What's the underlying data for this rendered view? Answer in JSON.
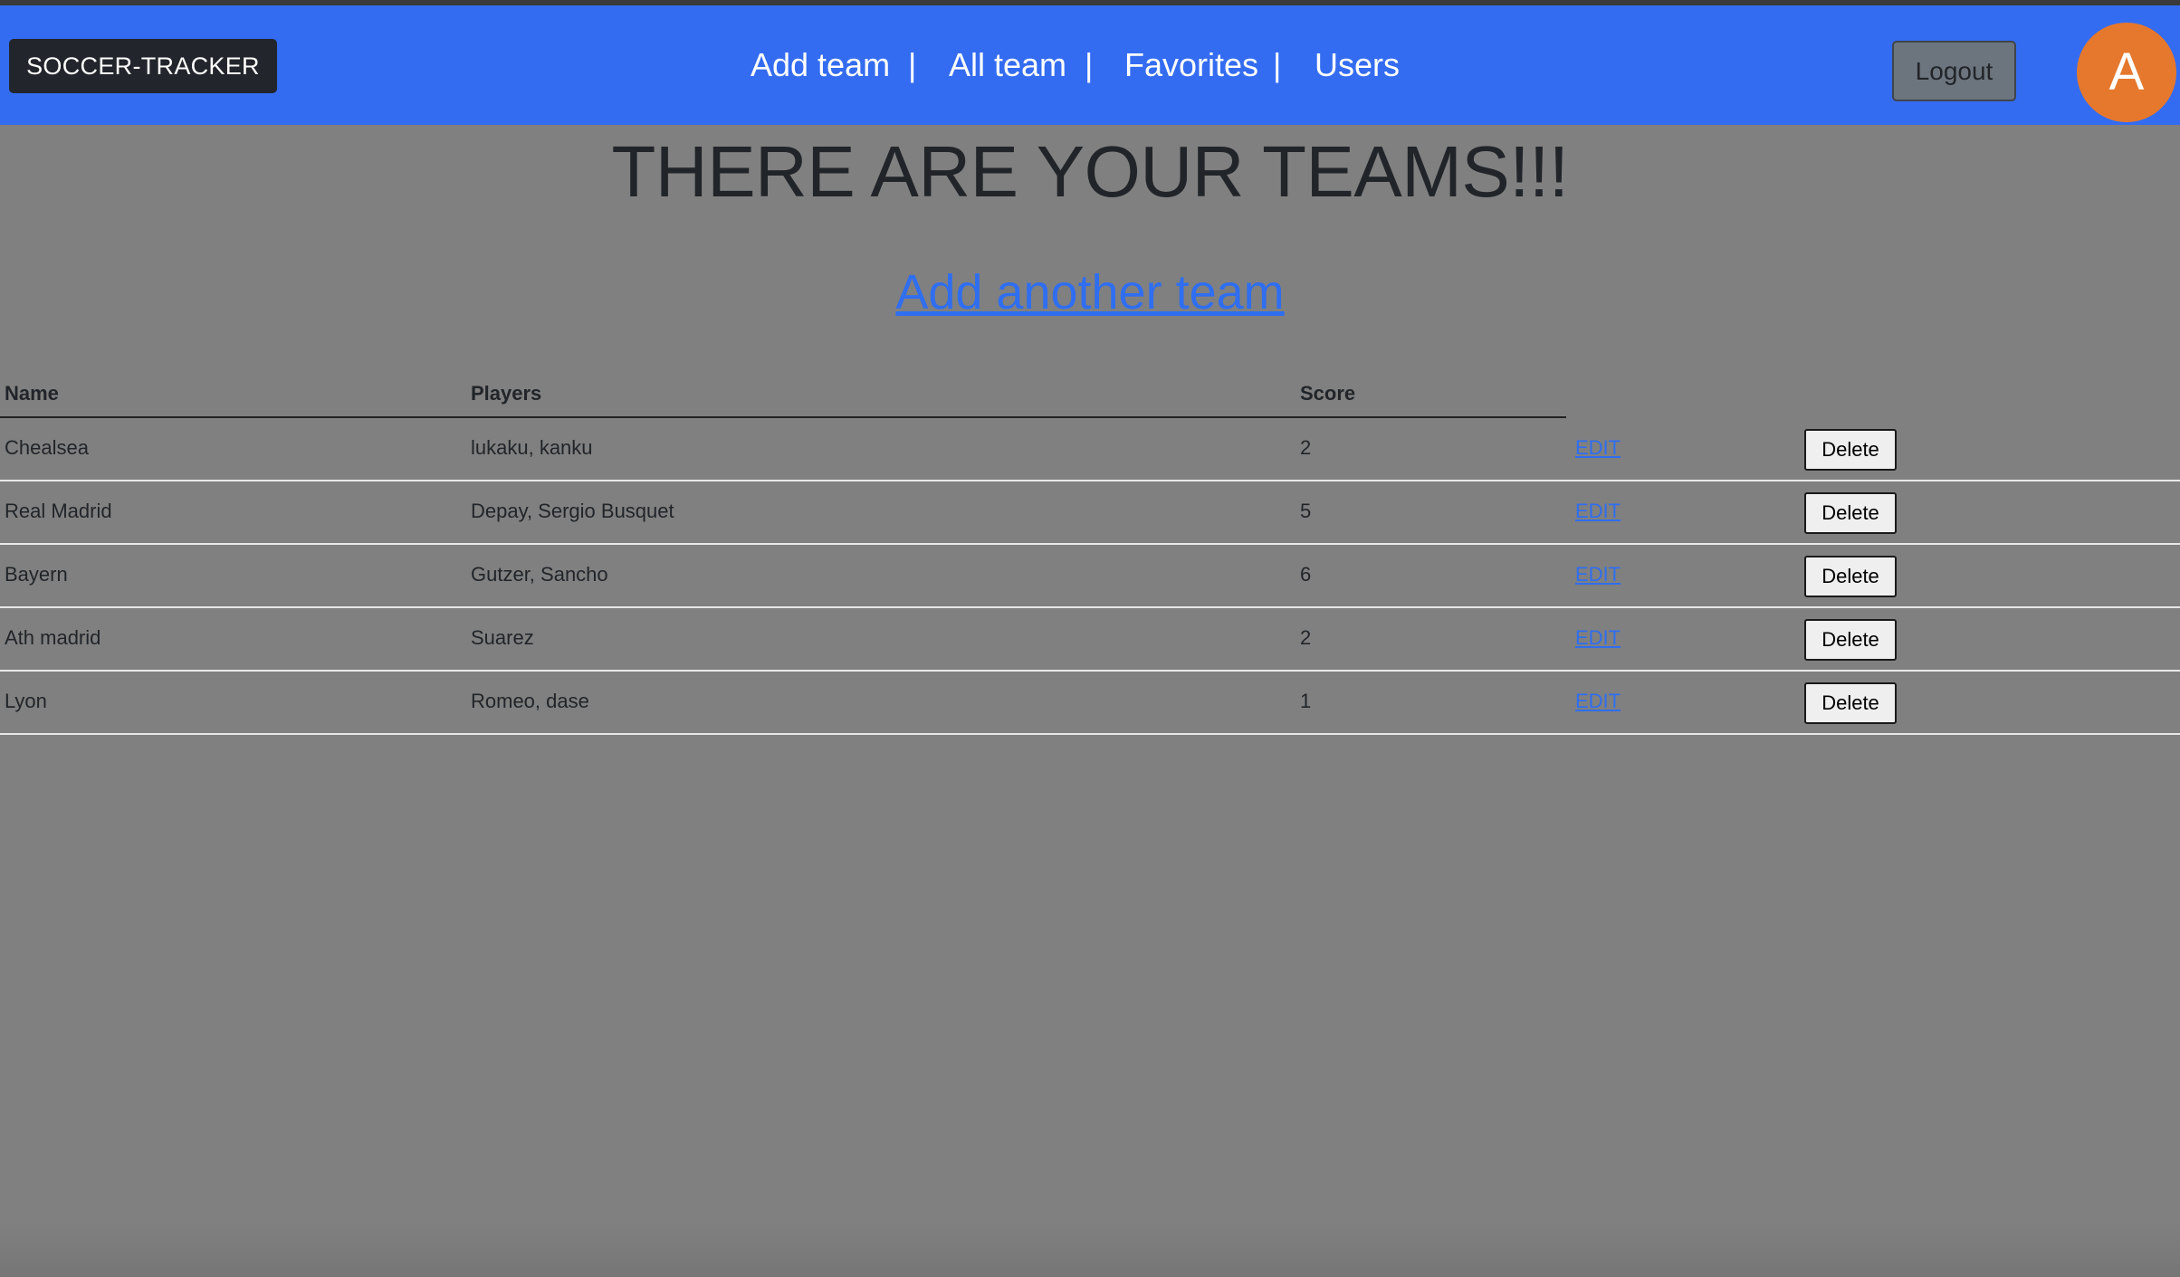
{
  "navbar": {
    "brand": "SOCCER-TRACKER",
    "links": [
      {
        "label": "Add team"
      },
      {
        "label": "All team"
      },
      {
        "label": "Favorites"
      },
      {
        "label": "Users"
      }
    ],
    "separator": "|",
    "logout_label": "Logout",
    "avatar_initial": "A",
    "colors": {
      "bar": "#346cf1",
      "avatar": "#e5782d"
    }
  },
  "main": {
    "title": "THERE ARE YOUR TEAMS!!!",
    "add_link": "Add another team"
  },
  "table": {
    "headers": {
      "name": "Name",
      "players": "Players",
      "score": "Score"
    },
    "edit_label": "EDIT",
    "delete_label": "Delete",
    "rows": [
      {
        "name": "Chealsea",
        "players": "lukaku, kanku",
        "score": "2"
      },
      {
        "name": "Real Madrid",
        "players": "Depay, Sergio Busquet",
        "score": "5"
      },
      {
        "name": "Bayern",
        "players": "Gutzer, Sancho",
        "score": "6"
      },
      {
        "name": "Ath madrid",
        "players": "Suarez",
        "score": "2"
      },
      {
        "name": "Lyon",
        "players": "Romeo, dase",
        "score": "1"
      }
    ]
  }
}
